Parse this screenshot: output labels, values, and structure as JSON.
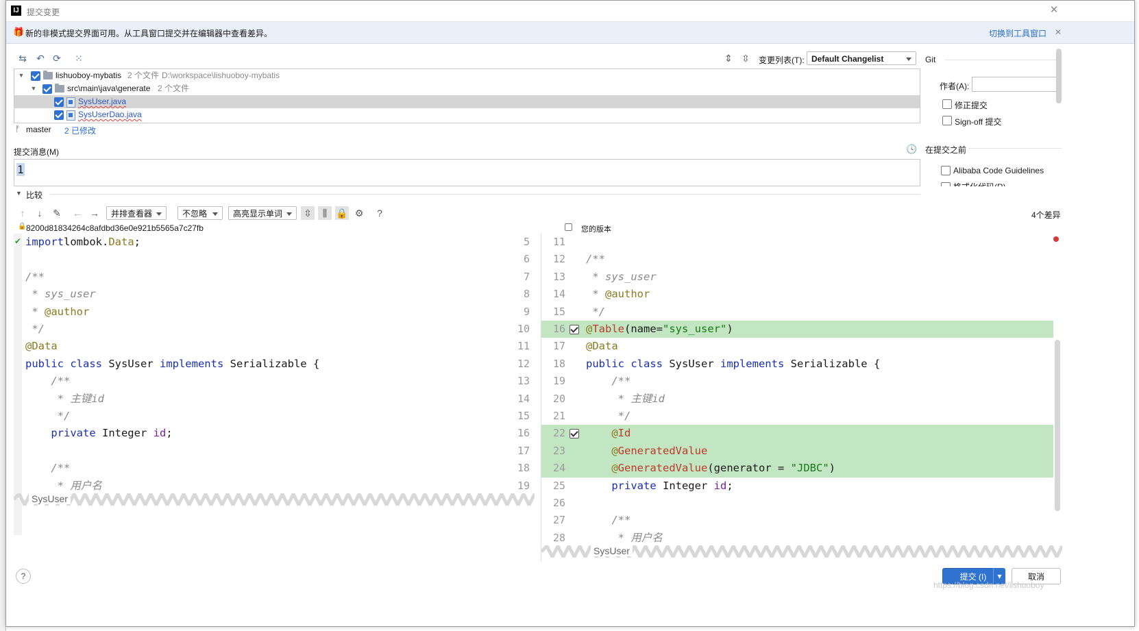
{
  "window": {
    "title": "提交变更",
    "banner_text": "新的非模式提交界面可用。从工具窗口提交并在编辑器中查看差异。",
    "banner_link": "切换到工具窗口"
  },
  "toolbar": {
    "changelist_label": "变更列表(T):",
    "changelist_value": "Default Changelist"
  },
  "tree": {
    "rows": [
      {
        "name": "lishuoboy-mybatis",
        "count": "2 个文件",
        "path": "D:\\workspace\\lishuoboy-mybatis"
      },
      {
        "name": "src\\main\\java\\generate",
        "count": "2 个文件"
      },
      {
        "name": "SysUser.java"
      },
      {
        "name": "SysUserDao.java"
      }
    ]
  },
  "status": {
    "branch": "master",
    "modified": "2 已修改"
  },
  "commit_message": {
    "label": "提交消息(M)",
    "value": "1"
  },
  "git_panel": {
    "title": "Git",
    "author_label": "作者(A):",
    "author_value": "",
    "amend_label": "修正提交",
    "signoff_label": "Sign-off 提交",
    "before_commit_label": "在提交之前",
    "alibaba_label": "Alibaba Code Guidelines",
    "cut_label": "格式化代码(R)"
  },
  "compare": {
    "section_label": "比较",
    "viewer_select": "并排查看器",
    "ignore_select": "不忽略",
    "highlight_select": "高亮显示单词",
    "diff_count": "4个差异",
    "left_hash": "8200d81834264c8afdbd36e0e921b5565a7c27fb",
    "right_label": "您的版本",
    "fold_label": "SysUser"
  },
  "left_code": [
    {
      "ln": "5",
      "parts": [
        [
          "kw",
          "import"
        ],
        [
          "",
          "lombok."
        ],
        [
          "an",
          "Data"
        ],
        [
          "",
          ";"
        ]
      ]
    },
    {
      "ln": "6",
      "parts": []
    },
    {
      "ln": "7",
      "parts": [
        [
          "cm",
          "/**"
        ]
      ]
    },
    {
      "ln": "8",
      "parts": [
        [
          "cm",
          " * sys_user"
        ]
      ]
    },
    {
      "ln": "9",
      "parts": [
        [
          "cm",
          " * "
        ],
        [
          "an",
          "@author"
        ]
      ]
    },
    {
      "ln": "10",
      "parts": [
        [
          "cm",
          " */"
        ]
      ]
    },
    {
      "ln": "11",
      "parts": [
        [
          "an",
          "@Data"
        ]
      ]
    },
    {
      "ln": "12",
      "parts": [
        [
          "kw",
          "public class "
        ],
        [
          "",
          "SysUser "
        ],
        [
          "kw",
          "implements "
        ],
        [
          "",
          "Serializable {"
        ]
      ]
    },
    {
      "ln": "13",
      "parts": [
        [
          "cm",
          "    /**"
        ]
      ]
    },
    {
      "ln": "14",
      "parts": [
        [
          "cm",
          "     * 主键id"
        ]
      ]
    },
    {
      "ln": "15",
      "parts": [
        [
          "cm",
          "     */"
        ]
      ]
    },
    {
      "ln": "16",
      "parts": [
        [
          "kw",
          "    private "
        ],
        [
          "",
          "Integer "
        ],
        [
          "fd",
          "id"
        ],
        [
          "",
          ";"
        ]
      ]
    },
    {
      "ln": "17",
      "parts": []
    },
    {
      "ln": "18",
      "parts": [
        [
          "cm",
          "    /**"
        ]
      ]
    },
    {
      "ln": "19",
      "parts": [
        [
          "cm",
          "     * 用户名"
        ]
      ]
    }
  ],
  "right_code": [
    {
      "ln": "11",
      "parts": []
    },
    {
      "ln": "12",
      "parts": [
        [
          "cm",
          "/**"
        ]
      ]
    },
    {
      "ln": "13",
      "parts": [
        [
          "cm",
          " * sys_user"
        ]
      ]
    },
    {
      "ln": "14",
      "parts": [
        [
          "cm",
          " * "
        ],
        [
          "an",
          "@author"
        ]
      ]
    },
    {
      "ln": "15",
      "parts": [
        [
          "cm",
          " */"
        ]
      ]
    },
    {
      "ln": "16",
      "added": true,
      "parts": [
        [
          "an",
          "@"
        ],
        [
          "ann2",
          "Table"
        ],
        [
          "",
          "(name="
        ],
        [
          "st",
          "\"sys_user\""
        ],
        [
          "",
          ")"
        ]
      ]
    },
    {
      "ln": "17",
      "parts": [
        [
          "an",
          "@Data"
        ]
      ]
    },
    {
      "ln": "18",
      "parts": [
        [
          "kw",
          "public class "
        ],
        [
          "",
          "SysUser "
        ],
        [
          "kw",
          "implements "
        ],
        [
          "",
          "Serializable {"
        ]
      ]
    },
    {
      "ln": "19",
      "parts": [
        [
          "cm",
          "    /**"
        ]
      ]
    },
    {
      "ln": "20",
      "parts": [
        [
          "cm",
          "     * 主键id"
        ]
      ]
    },
    {
      "ln": "21",
      "parts": [
        [
          "cm",
          "     */"
        ]
      ]
    },
    {
      "ln": "22",
      "added": true,
      "parts": [
        [
          "an",
          "    @"
        ],
        [
          "ann2",
          "Id"
        ]
      ]
    },
    {
      "ln": "23",
      "added": true,
      "parts": [
        [
          "an",
          "    @"
        ],
        [
          "ann2",
          "GeneratedValue"
        ]
      ]
    },
    {
      "ln": "24",
      "added": true,
      "parts": [
        [
          "an",
          "    @"
        ],
        [
          "ann2",
          "GeneratedValue"
        ],
        [
          "",
          "(generator = "
        ],
        [
          "st",
          "\"JDBC\""
        ],
        [
          "",
          ")"
        ]
      ]
    },
    {
      "ln": "25",
      "parts": [
        [
          "kw",
          "    private "
        ],
        [
          "",
          "Integer "
        ],
        [
          "fd",
          "id"
        ],
        [
          "",
          ";"
        ]
      ]
    },
    {
      "ln": "26",
      "parts": []
    },
    {
      "ln": "27",
      "parts": [
        [
          "cm",
          "    /**"
        ]
      ]
    },
    {
      "ln": "28",
      "parts": [
        [
          "cm",
          "     * 用户名"
        ]
      ]
    }
  ],
  "footer": {
    "help": "?",
    "commit_button": "提交 (I)",
    "cancel_button": "取消",
    "watermark": "https://blog.csdn.net/lishuoboy"
  },
  "colors": {
    "accent": "#2f72cf",
    "added_bg": "#c2e6c2"
  }
}
